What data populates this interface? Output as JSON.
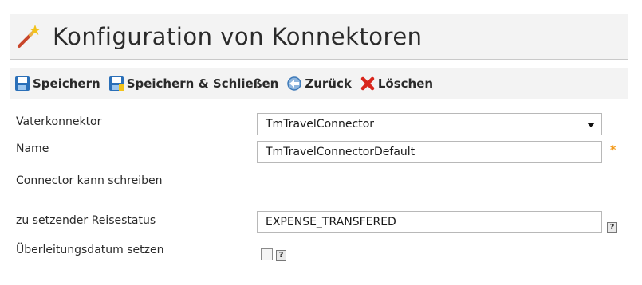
{
  "header": {
    "title": "Konfiguration von Konnektoren",
    "icon": "magic-wand-icon"
  },
  "toolbar": {
    "save_label": "Speichern",
    "save_close_label": "Speichern & Schließen",
    "back_label": "Zurück",
    "delete_label": "Löschen"
  },
  "form": {
    "parent_connector": {
      "label": "Vaterkonnektor",
      "value": "TmTravelConnector"
    },
    "name": {
      "label": "Name",
      "value": "TmTravelConnectorDefault",
      "required_marker": "*"
    },
    "can_write": {
      "label": "Connector kann schreiben"
    },
    "travel_status": {
      "label": "zu setzender Reisestatus",
      "value": "EXPENSE_TRANSFERED",
      "help": "?"
    },
    "transfer_date": {
      "label": "Überleitungsdatum setzen",
      "checked": false,
      "help": "?"
    }
  },
  "colors": {
    "panel_bg": "#f3f3f3",
    "required": "#f39a1a",
    "save_icon": "#2a6fb8",
    "delete_icon": "#d9261c"
  }
}
